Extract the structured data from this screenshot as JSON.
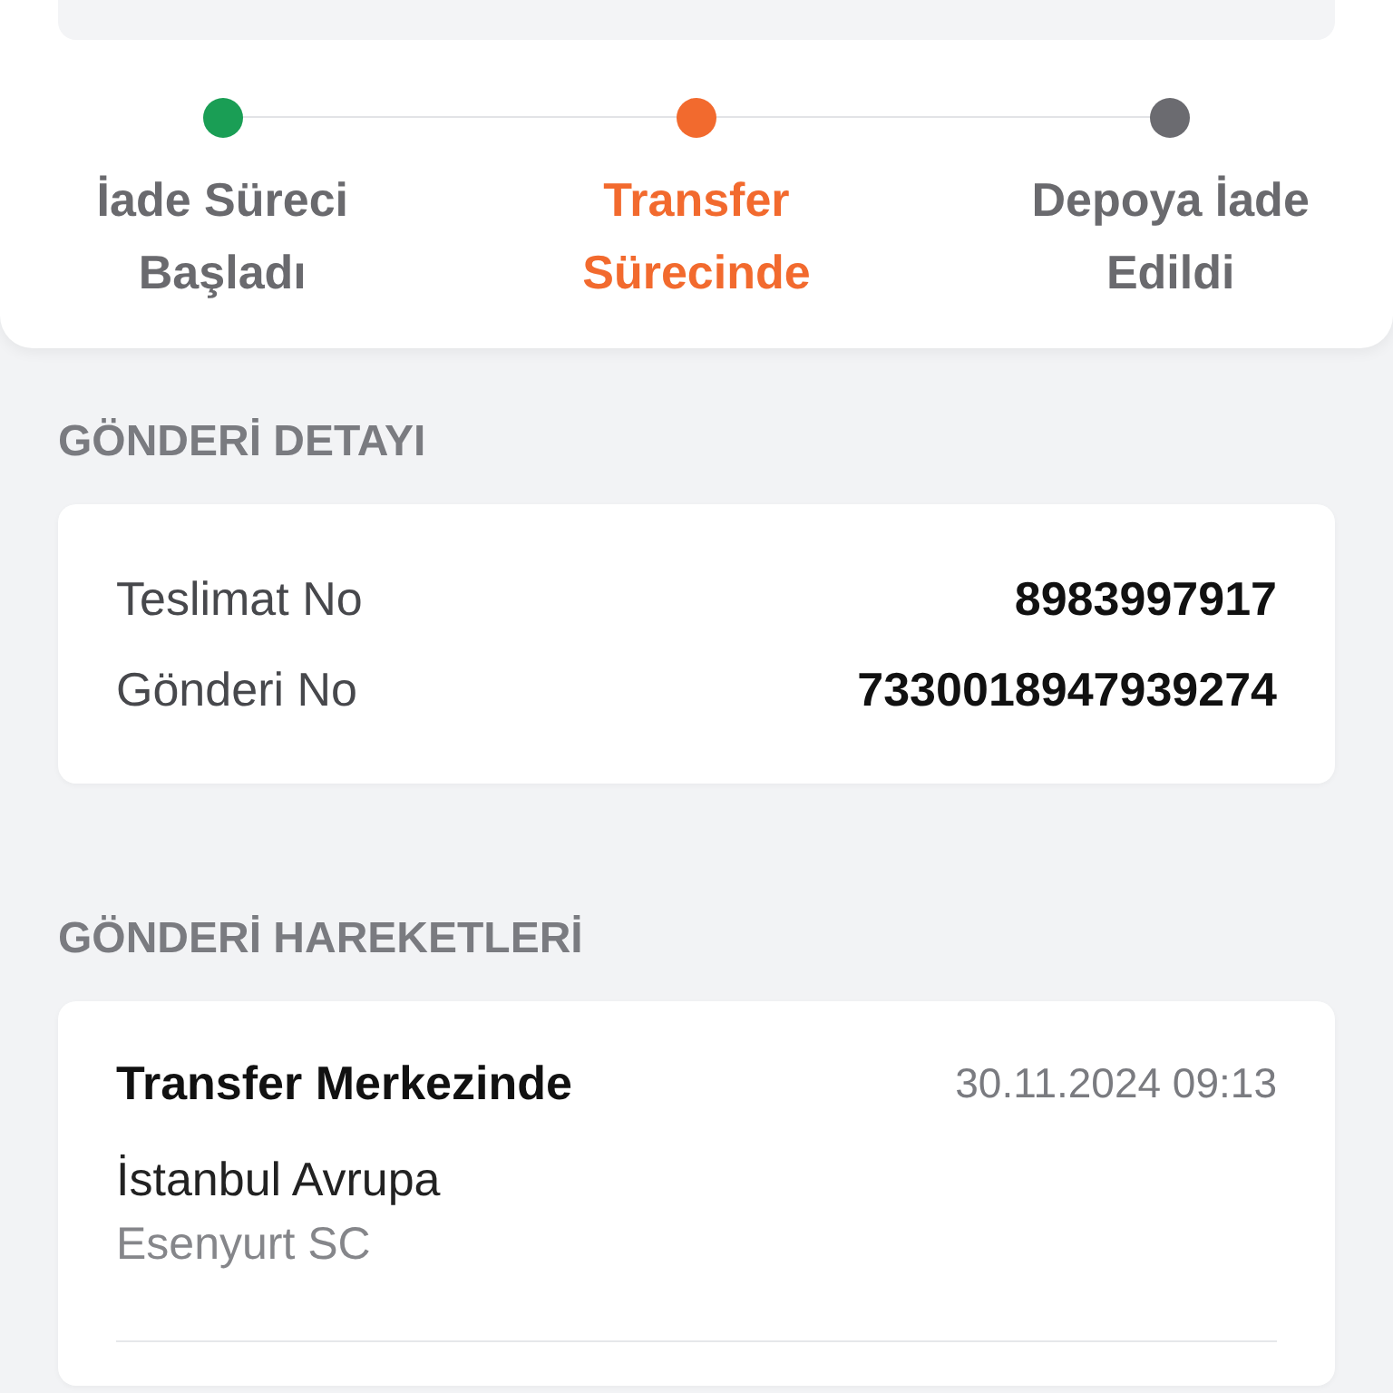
{
  "steps": [
    {
      "label": "İade Süreci Başladı",
      "selected": false,
      "color": "#1a9e55"
    },
    {
      "label": "Transfer Sürecinde",
      "selected": true,
      "color": "#f26a2e"
    },
    {
      "label": "Depoya İade Edildi",
      "selected": false,
      "color": "#6b6b70"
    }
  ],
  "details": {
    "title": "GÖNDERİ DETAYI",
    "rows": [
      {
        "label": "Teslimat No",
        "value": "8983997917"
      },
      {
        "label": "Gönderi No",
        "value": "7330018947939274"
      }
    ]
  },
  "movements": {
    "title": "GÖNDERİ HAREKETLERİ",
    "events": [
      {
        "title": "Transfer Merkezinde",
        "time": "30.11.2024 09:13",
        "place": "İstanbul Avrupa",
        "branch": "Esenyurt SC"
      }
    ]
  }
}
